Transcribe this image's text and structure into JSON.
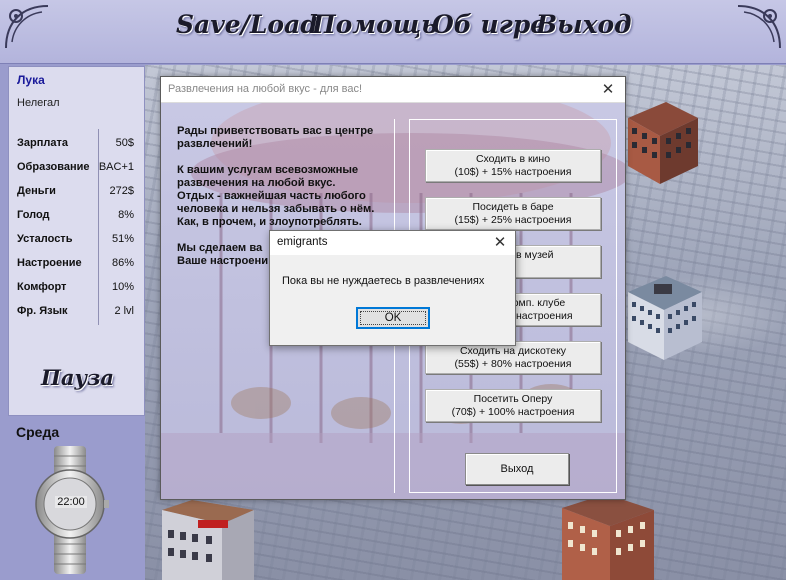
{
  "menu": {
    "save_load": "Save/Load",
    "help": "Помощь",
    "about": "Об игре",
    "exit": "Выход"
  },
  "player": {
    "name": "Лука",
    "status": "Нелегал"
  },
  "stats": [
    {
      "label": "Зарплата",
      "value": "50$"
    },
    {
      "label": "Образование",
      "value": "BAC+1"
    },
    {
      "label": "Деньги",
      "value": "272$"
    },
    {
      "label": "Голод",
      "value": "8%"
    },
    {
      "label": "Усталость",
      "value": "51%"
    },
    {
      "label": "Настроение",
      "value": "86%"
    },
    {
      "label": "Комфорт",
      "value": "10%"
    },
    {
      "label": "Фр. Язык",
      "value": "2 lvl"
    }
  ],
  "pause_label": "Пауза",
  "day": "Среда",
  "clock_time": "22:00",
  "main_dialog": {
    "title": "Развлечения на любой вкус - для вас!",
    "close_glyph": "✕",
    "welcome_text": "Рады приветствовать вас в центре развлечений!\n\nК вашим услугам всевозможные развлечения на любой вкус.\nОтдых - важнейшая часть любого человека и нельзя забывать о нём. Как, в прочем, и злоупотреблять.\n\nМы сделаем ва\nВаше настроени",
    "buttons": [
      {
        "line1": "Сходить в кино",
        "line2": "(10$) + 15% настроения"
      },
      {
        "line1": "Посидеть в баре",
        "line2": "(15$) + 25% настроения"
      },
      {
        "line1": "в музей",
        "line2": ""
      },
      {
        "line1": "комп. клубе",
        "line2": "настроения"
      },
      {
        "line1": "Сходить на дискотеку",
        "line2": "(55$) + 80% настроения"
      },
      {
        "line1": "Посетить Оперу",
        "line2": "(70$) + 100% настроения"
      }
    ],
    "exit_label": "Выход"
  },
  "message_box": {
    "title": "emigrants",
    "close_glyph": "✕",
    "text": "Пока вы не нуждаетесь в развлечениях",
    "ok_label": "OK"
  }
}
